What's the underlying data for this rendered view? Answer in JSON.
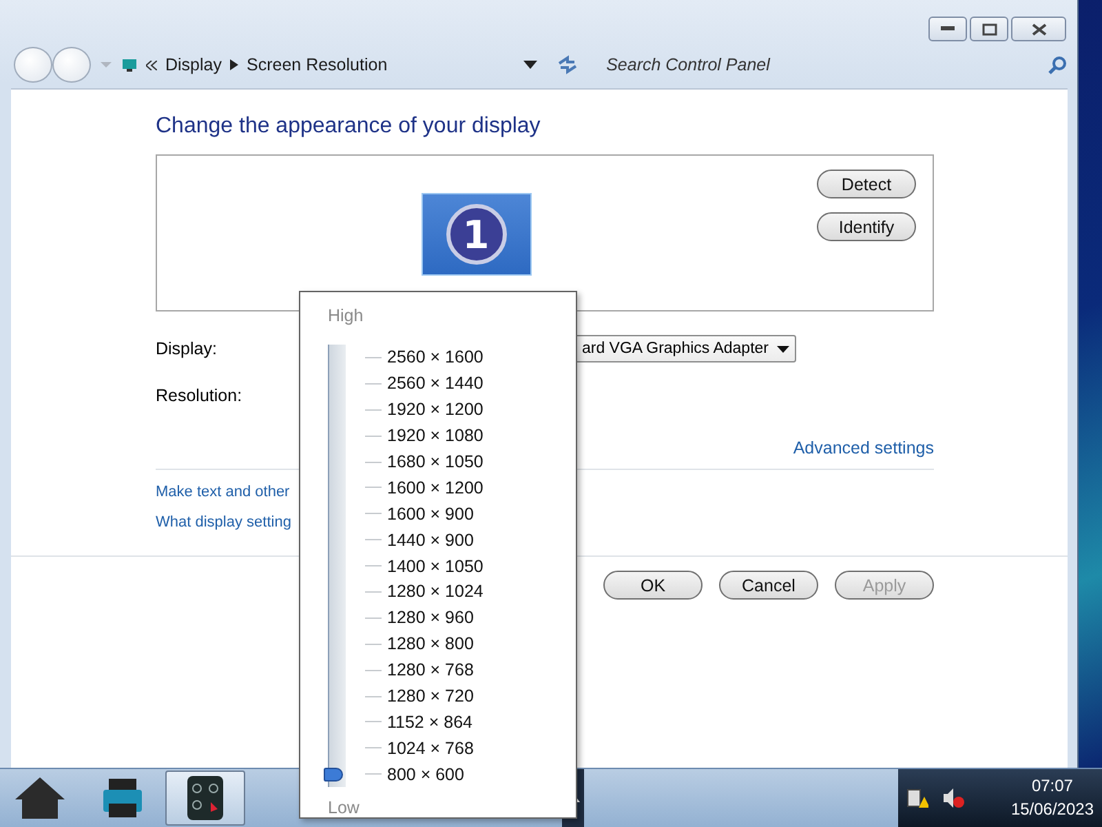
{
  "window": {
    "breadcrumb": [
      "Display",
      "Screen Resolution"
    ],
    "search": {
      "placeholder": "Search Control Panel"
    }
  },
  "heading": "Change the appearance of your display",
  "preview": {
    "monitor_number": "1",
    "buttons": [
      "Detect",
      "Identify"
    ]
  },
  "fields": [
    {
      "label": "Display:",
      "value": "ard VGA Graphics Adapter"
    },
    {
      "label": "Resolution:"
    }
  ],
  "advanced_link": "Advanced settings",
  "links": [
    "Make text and other",
    "What display setting"
  ],
  "buttons": [
    {
      "label": "OK",
      "disabled": false
    },
    {
      "label": "Cancel",
      "disabled": false
    },
    {
      "label": "Apply",
      "disabled": true
    }
  ],
  "resolution_popup": {
    "high_label": "High",
    "low_label": "Low",
    "level": 0,
    "options": [
      "2560 × 1600",
      "2560 × 1440",
      "1920 × 1200",
      "1920 × 1080",
      "1680 × 1050",
      "1600 × 1200",
      "1600 × 900",
      "1440 × 900",
      "1400 × 1050",
      "1280 × 1024",
      "1280 × 960",
      "1280 × 800",
      "1280 × 768",
      "1280 × 720",
      "1152 × 864",
      "1024 × 768",
      "800 × 600"
    ]
  },
  "taskbar": {
    "apps": [
      {
        "kind": "home",
        "selected": false
      },
      {
        "kind": "printer",
        "selected": false
      },
      {
        "kind": "remote",
        "selected": true
      }
    ],
    "clock": {
      "time": "07:07",
      "date": "15/06/2023"
    }
  }
}
